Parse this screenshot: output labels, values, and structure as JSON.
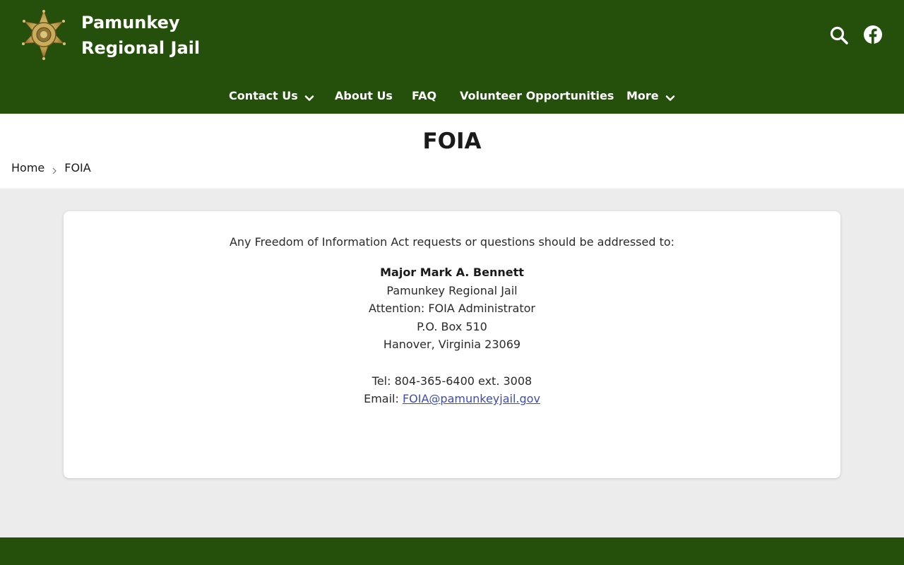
{
  "site": {
    "name": "Pamunkey Regional Jail",
    "name_line1": "Pamunkey",
    "name_line2": "Regional Jail",
    "accent_color": "#24500b"
  },
  "header_icons": {
    "search": "search-icon",
    "facebook": "facebook-icon"
  },
  "nav": {
    "items": [
      {
        "label": "Contact Us",
        "has_dropdown": true
      },
      {
        "label": "About Us",
        "has_dropdown": false
      },
      {
        "label": "FAQ",
        "has_dropdown": false
      },
      {
        "label": "Volunteer Opportunities",
        "has_dropdown": false
      },
      {
        "label": "More",
        "has_dropdown": true
      }
    ]
  },
  "page": {
    "title": "FOIA",
    "breadcrumb": [
      "Home",
      "FOIA"
    ]
  },
  "content": {
    "intro": "Any Freedom of Information Act requests or questions should be addressed to:",
    "contact_name": "Major Mark A. Bennett",
    "org": "Pamunkey Regional Jail",
    "attention": "Attention: FOIA Administrator",
    "po_box": "P.O. Box 510",
    "city_state_zip": "Hanover, Virginia 23069",
    "tel": "Tel: 804-365-6400 ext. 3008",
    "email_label": "Email:",
    "email": "FOIA@pamunkeyjail.gov",
    "link_color": "#3b4bbd"
  }
}
